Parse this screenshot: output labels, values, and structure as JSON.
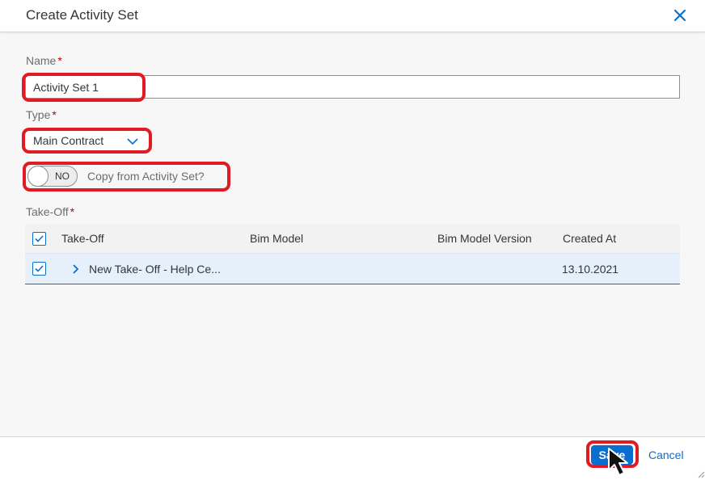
{
  "dialog": {
    "title": "Create Activity Set"
  },
  "form": {
    "name_label": "Name",
    "name_value": "Activity Set 1",
    "required_mark": "*",
    "type_label": "Type",
    "type_value": "Main Contract",
    "copy_toggle": {
      "state_text": "NO",
      "label": "Copy from Activity Set?"
    },
    "takeoff_label": "Take-Off"
  },
  "table": {
    "columns": [
      "Take-Off",
      "Bim Model",
      "Bim Model Version",
      "Created At"
    ],
    "rows": [
      {
        "takeoff": "New Take- Off - Help Ce...",
        "bim_model": "",
        "bim_model_version": "",
        "created_at": "13.10.2021",
        "selected": true
      }
    ]
  },
  "footer": {
    "save_label": "Save",
    "cancel_label": "Cancel"
  },
  "colors": {
    "accent": "#0a6ed1",
    "highlight": "#e01b24",
    "required": "#bb0000",
    "selected_row": "#e5f0fa"
  },
  "icons": {
    "close": "close-icon",
    "select_arrow": "chevron-down-icon",
    "row_expand": "chevron-right-icon",
    "checkbox": "checkmark-icon",
    "pointer": "mouse-cursor-icon"
  }
}
